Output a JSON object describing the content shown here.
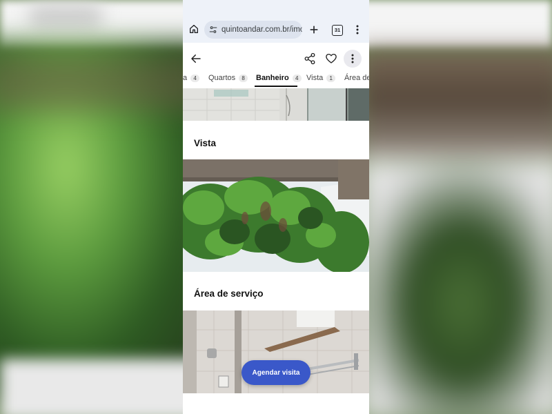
{
  "browser": {
    "url": "quintoandar.com.br/imo",
    "tab_count": "31"
  },
  "gallery": {
    "tabs": [
      {
        "label": "a",
        "count": "4",
        "active": false
      },
      {
        "label": "Quartos",
        "count": "8",
        "active": false
      },
      {
        "label": "Banheiro",
        "count": "4",
        "active": true
      },
      {
        "label": "Vista",
        "count": "1",
        "active": false
      },
      {
        "label": "Área de",
        "count": "",
        "active": false
      }
    ],
    "sections": [
      {
        "title": "Vista"
      },
      {
        "title": "Área de serviço"
      }
    ]
  },
  "cta": {
    "label": "Agendar visita",
    "color": "#3a58c9"
  },
  "icons": [
    "home-icon",
    "tune-icon",
    "plus-icon",
    "tabs-icon",
    "more-vert-icon",
    "arrow-back-icon",
    "share-icon",
    "heart-icon"
  ]
}
